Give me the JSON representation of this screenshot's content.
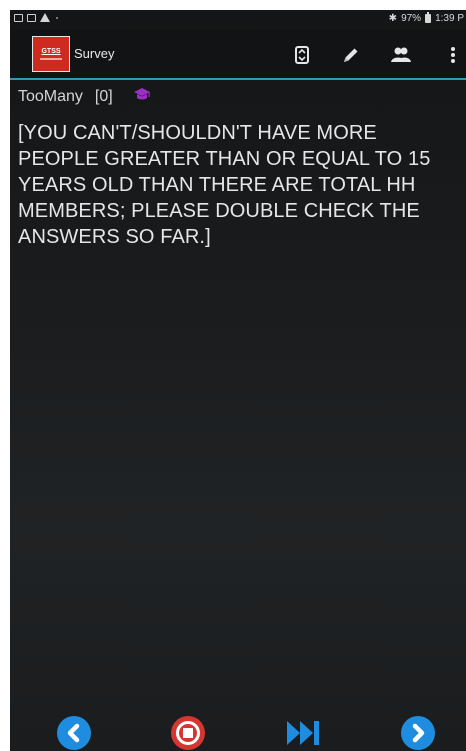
{
  "status_bar": {
    "battery": "97%",
    "time": "1:39 P"
  },
  "action_bar": {
    "logo_text": "GTSS",
    "title": "Survey",
    "icons": [
      "swap-screen-icon",
      "pencil-icon",
      "people-icon",
      "overflow-menu-icon"
    ],
    "accent": "#2f9ab8"
  },
  "question": {
    "name": "TooMany",
    "index": "[0]",
    "text": "[YOU CAN'T/SHOULDN'T HAVE MORE PEOPLE GREATER THAN OR EQUAL TO 15 YEARS OLD THAN THERE ARE TOTAL HH MEMBERS; PLEASE DOUBLE CHECK THE ANSWERS SO FAR.]",
    "hint_icon": "graduation-cap-icon",
    "hint_color": "#9b2fc7"
  },
  "bottom_nav": {
    "buttons": [
      "previous-icon",
      "stop-icon",
      "fast-forward-icon",
      "next-icon"
    ],
    "nav_color": "#1e8de0",
    "stop_color": "#d63632"
  }
}
